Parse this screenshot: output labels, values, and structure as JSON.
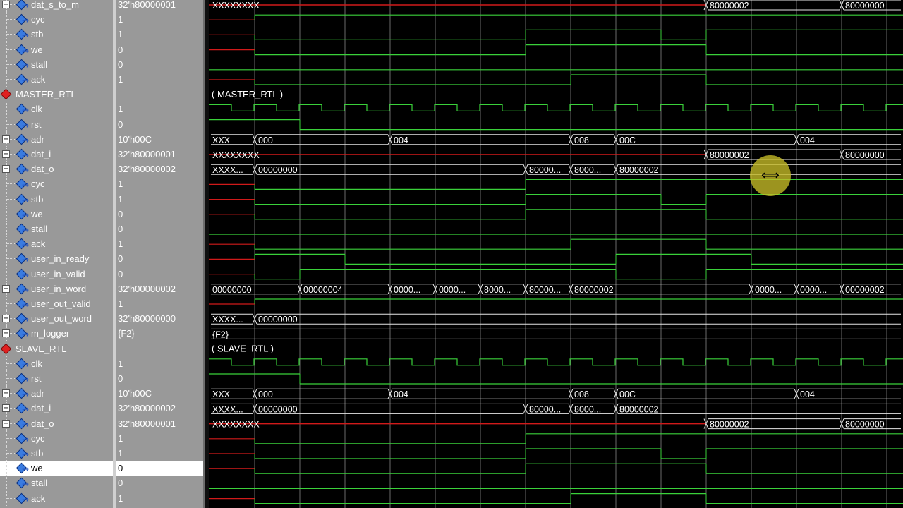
{
  "rows": [
    {
      "name": "dat_s_to_m",
      "value": "32'h80000001",
      "indent": 1,
      "type": "bus",
      "expandable": true,
      "selected": false
    },
    {
      "name": "cyc",
      "value": "1",
      "indent": 1,
      "type": "bit",
      "expandable": false,
      "selected": false
    },
    {
      "name": "stb",
      "value": "1",
      "indent": 1,
      "type": "bit",
      "expandable": false,
      "selected": false
    },
    {
      "name": "we",
      "value": "0",
      "indent": 1,
      "type": "bit",
      "expandable": false,
      "selected": false
    },
    {
      "name": "stall",
      "value": "0",
      "indent": 1,
      "type": "bit",
      "expandable": false,
      "selected": false
    },
    {
      "name": "ack",
      "value": "1",
      "indent": 1,
      "type": "bit",
      "expandable": false,
      "selected": false
    },
    {
      "name": "MASTER_RTL",
      "value": "",
      "indent": 0,
      "type": "group",
      "expandable": false,
      "selected": false
    },
    {
      "name": "clk",
      "value": "1",
      "indent": 1,
      "type": "bit",
      "expandable": false,
      "selected": false
    },
    {
      "name": "rst",
      "value": "0",
      "indent": 1,
      "type": "bit",
      "expandable": false,
      "selected": false
    },
    {
      "name": "adr",
      "value": "10'h00C",
      "indent": 1,
      "type": "bus",
      "expandable": true,
      "selected": false
    },
    {
      "name": "dat_i",
      "value": "32'h80000001",
      "indent": 1,
      "type": "bus",
      "expandable": true,
      "selected": false
    },
    {
      "name": "dat_o",
      "value": "32'h80000002",
      "indent": 1,
      "type": "bus",
      "expandable": true,
      "selected": false
    },
    {
      "name": "cyc",
      "value": "1",
      "indent": 1,
      "type": "bit",
      "expandable": false,
      "selected": false
    },
    {
      "name": "stb",
      "value": "1",
      "indent": 1,
      "type": "bit",
      "expandable": false,
      "selected": false
    },
    {
      "name": "we",
      "value": "0",
      "indent": 1,
      "type": "bit",
      "expandable": false,
      "selected": false
    },
    {
      "name": "stall",
      "value": "0",
      "indent": 1,
      "type": "bit",
      "expandable": false,
      "selected": false
    },
    {
      "name": "ack",
      "value": "1",
      "indent": 1,
      "type": "bit",
      "expandable": false,
      "selected": false
    },
    {
      "name": "user_in_ready",
      "value": "0",
      "indent": 1,
      "type": "bit",
      "expandable": false,
      "selected": false
    },
    {
      "name": "user_in_valid",
      "value": "0",
      "indent": 1,
      "type": "bit",
      "expandable": false,
      "selected": false
    },
    {
      "name": "user_in_word",
      "value": "32'h00000002",
      "indent": 1,
      "type": "bus",
      "expandable": true,
      "selected": false
    },
    {
      "name": "user_out_valid",
      "value": "1",
      "indent": 1,
      "type": "bit",
      "expandable": false,
      "selected": false
    },
    {
      "name": "user_out_word",
      "value": "32'h80000000",
      "indent": 1,
      "type": "bus",
      "expandable": true,
      "selected": false
    },
    {
      "name": "m_logger",
      "value": "{F2}",
      "indent": 1,
      "type": "bus",
      "expandable": true,
      "selected": false
    },
    {
      "name": "SLAVE_RTL",
      "value": "",
      "indent": 0,
      "type": "group",
      "expandable": false,
      "selected": false
    },
    {
      "name": "clk",
      "value": "1",
      "indent": 1,
      "type": "bit",
      "expandable": false,
      "selected": false
    },
    {
      "name": "rst",
      "value": "0",
      "indent": 1,
      "type": "bit",
      "expandable": false,
      "selected": false
    },
    {
      "name": "adr",
      "value": "10'h00C",
      "indent": 1,
      "type": "bus",
      "expandable": true,
      "selected": false
    },
    {
      "name": "dat_i",
      "value": "32'h80000002",
      "indent": 1,
      "type": "bus",
      "expandable": true,
      "selected": false
    },
    {
      "name": "dat_o",
      "value": "32'h80000001",
      "indent": 1,
      "type": "bus",
      "expandable": true,
      "selected": false
    },
    {
      "name": "cyc",
      "value": "1",
      "indent": 1,
      "type": "bit",
      "expandable": false,
      "selected": false
    },
    {
      "name": "stb",
      "value": "1",
      "indent": 1,
      "type": "bit",
      "expandable": false,
      "selected": false
    },
    {
      "name": "we",
      "value": "0",
      "indent": 1,
      "type": "bit",
      "expandable": false,
      "selected": true
    },
    {
      "name": "stall",
      "value": "0",
      "indent": 1,
      "type": "bit",
      "expandable": false,
      "selected": false
    },
    {
      "name": "ack",
      "value": "1",
      "indent": 1,
      "type": "bit",
      "expandable": false,
      "selected": false
    }
  ],
  "waves": {
    "clk": {
      "kind": "clock"
    },
    "bits": {
      "ws_cyc": {
        "init": "x",
        "changes": [
          [
            1,
            1
          ]
        ]
      },
      "ws_stb": {
        "init": "x",
        "changes": [
          [
            1,
            0
          ],
          [
            7,
            1
          ],
          [
            10,
            0
          ],
          [
            11,
            1
          ]
        ]
      },
      "ws_we": {
        "init": "x",
        "changes": [
          [
            1,
            0
          ],
          [
            7,
            1
          ],
          [
            11,
            0
          ]
        ]
      },
      "ws_stall": {
        "init": "x",
        "changes": [
          [
            0,
            0
          ]
        ]
      },
      "ws_ack": {
        "init": "x",
        "changes": [
          [
            1,
            0
          ],
          [
            8,
            1
          ],
          [
            11,
            0
          ]
        ]
      },
      "m_rst": {
        "init": "1",
        "changes": [
          [
            2,
            0
          ]
        ]
      },
      "m_cyc": {
        "init": "x",
        "changes": [
          [
            1,
            0
          ],
          [
            7,
            1
          ]
        ]
      },
      "m_stb": {
        "init": "x",
        "changes": [
          [
            1,
            0
          ],
          [
            7,
            1
          ],
          [
            10,
            0
          ],
          [
            11,
            1
          ]
        ]
      },
      "m_we": {
        "init": "x",
        "changes": [
          [
            1,
            0
          ],
          [
            7,
            1
          ],
          [
            11,
            0
          ]
        ]
      },
      "m_stall": {
        "init": "x",
        "changes": [
          [
            0,
            0
          ]
        ]
      },
      "m_ack": {
        "init": "x",
        "changes": [
          [
            1,
            0
          ],
          [
            8,
            1
          ],
          [
            11,
            0
          ]
        ]
      },
      "m_uir": {
        "init": "x",
        "changes": [
          [
            1,
            1
          ],
          [
            3,
            0
          ],
          [
            9,
            1
          ],
          [
            12,
            0
          ]
        ]
      },
      "m_uiv": {
        "init": "x",
        "changes": [
          [
            1,
            0
          ],
          [
            2,
            1
          ],
          [
            9,
            0
          ],
          [
            11,
            1
          ]
        ]
      },
      "m_uov": {
        "init": "x",
        "changes": [
          [
            1,
            1
          ]
        ]
      },
      "s_rst": {
        "init": "1",
        "changes": [
          [
            2,
            0
          ]
        ]
      },
      "s_cyc": {
        "init": "x",
        "changes": [
          [
            1,
            0
          ],
          [
            7,
            1
          ]
        ]
      },
      "s_stb": {
        "init": "x",
        "changes": [
          [
            1,
            0
          ],
          [
            7,
            1
          ],
          [
            10,
            0
          ],
          [
            11,
            1
          ]
        ]
      },
      "s_we": {
        "init": "x",
        "changes": [
          [
            1,
            0
          ],
          [
            7,
            1
          ],
          [
            11,
            0
          ]
        ]
      },
      "s_stall": {
        "init": "x",
        "changes": [
          [
            0,
            0
          ]
        ]
      },
      "s_ack": {
        "init": "x",
        "changes": [
          [
            1,
            0
          ],
          [
            8,
            1
          ],
          [
            11,
            0
          ]
        ]
      }
    },
    "buses": {
      "ws_dat": [
        {
          "t": 0,
          "label": "XXXXXXXX",
          "x": true
        },
        {
          "t": 11,
          "label": "80000002"
        },
        {
          "t": 14,
          "label": "80000000"
        }
      ],
      "m_adr": [
        {
          "t": 0,
          "label": "XXX"
        },
        {
          "t": 1,
          "label": "000"
        },
        {
          "t": 4,
          "label": "004"
        },
        {
          "t": 8,
          "label": "008"
        },
        {
          "t": 9,
          "label": "00C"
        },
        {
          "t": 13,
          "label": "004"
        }
      ],
      "m_dati": [
        {
          "t": 0,
          "label": "XXXXXXXX",
          "x": true
        },
        {
          "t": 11,
          "label": "80000002"
        },
        {
          "t": 14,
          "label": "80000000"
        }
      ],
      "m_dato": [
        {
          "t": 0,
          "label": "XXXX..."
        },
        {
          "t": 1,
          "label": "00000000"
        },
        {
          "t": 7,
          "label": "80000..."
        },
        {
          "t": 8,
          "label": "8000..."
        },
        {
          "t": 9,
          "label": "80000002"
        }
      ],
      "m_uiw": [
        {
          "t": 0,
          "label": "00000000"
        },
        {
          "t": 2,
          "label": "00000004"
        },
        {
          "t": 4,
          "label": "0000..."
        },
        {
          "t": 5,
          "label": "0000..."
        },
        {
          "t": 6,
          "label": "8000..."
        },
        {
          "t": 7,
          "label": "80000..."
        },
        {
          "t": 8,
          "label": "80000002"
        },
        {
          "t": 12,
          "label": "0000..."
        },
        {
          "t": 13,
          "label": "0000..."
        },
        {
          "t": 14,
          "label": "00000002"
        }
      ],
      "m_uow": [
        {
          "t": 0,
          "label": "XXXX..."
        },
        {
          "t": 1,
          "label": "00000000"
        }
      ],
      "m_log": [
        {
          "t": 0,
          "label": "{F2}"
        }
      ],
      "s_adr": [
        {
          "t": 0,
          "label": "XXX"
        },
        {
          "t": 1,
          "label": "000"
        },
        {
          "t": 4,
          "label": "004"
        },
        {
          "t": 8,
          "label": "008"
        },
        {
          "t": 9,
          "label": "00C"
        },
        {
          "t": 13,
          "label": "004"
        }
      ],
      "s_dati": [
        {
          "t": 0,
          "label": "XXXX..."
        },
        {
          "t": 1,
          "label": "00000000"
        },
        {
          "t": 7,
          "label": "80000..."
        },
        {
          "t": 8,
          "label": "8000..."
        },
        {
          "t": 9,
          "label": "80000002"
        }
      ],
      "s_dato": [
        {
          "t": 0,
          "label": "XXXXXXXX",
          "x": true
        },
        {
          "t": 11,
          "label": "80000002"
        },
        {
          "t": 14,
          "label": "80000000"
        }
      ]
    },
    "groups": [
      {
        "row": 6,
        "label": "( MASTER_RTL )"
      },
      {
        "row": 23,
        "label": "( SLAVE_RTL )"
      }
    ]
  },
  "colors": {
    "wave_green": "#3ad13a",
    "undefined_red": "#d11a1a",
    "panel_gray": "#999999",
    "bus_white": "#e6e6e6",
    "cursor_yellow": "#c8be28"
  },
  "cursor": {
    "icon": "resize-horizontal-icon",
    "glyph": "⟺"
  }
}
